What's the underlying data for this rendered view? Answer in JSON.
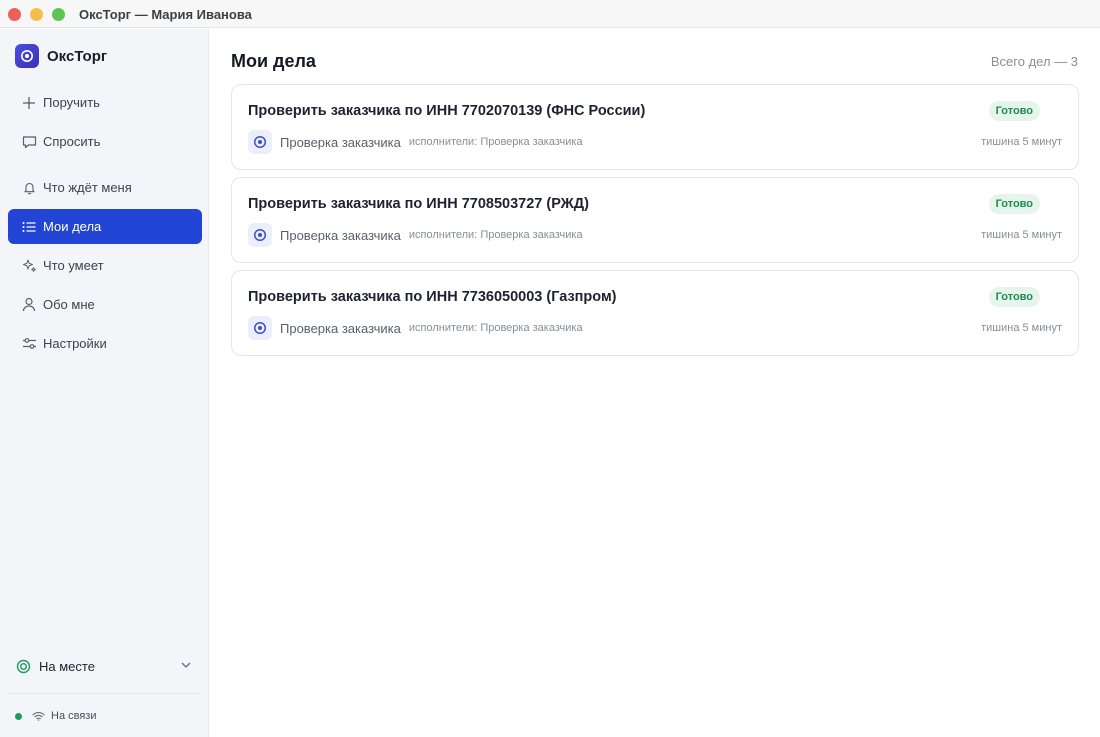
{
  "window": {
    "title": "ОксТорг — Мария Иванова"
  },
  "brand": {
    "name": "ОксТорг"
  },
  "sidebar": {
    "items": [
      {
        "label": "Поручить",
        "icon": "plus-icon",
        "active": false
      },
      {
        "label": "Спросить",
        "icon": "chat-icon",
        "active": false
      },
      {
        "label": "Что ждёт меня",
        "icon": "bell-icon",
        "active": false
      },
      {
        "label": "Мои дела",
        "icon": "list-icon",
        "active": true
      },
      {
        "label": "Что умеет",
        "icon": "sparkle-icon",
        "active": false
      },
      {
        "label": "Обо мне",
        "icon": "user-icon",
        "active": false
      },
      {
        "label": "Настройки",
        "icon": "sliders-icon",
        "active": false
      }
    ],
    "presence": {
      "label": "На месте",
      "icon": "presence-icon"
    },
    "connection": {
      "label": "На связи",
      "icon": "wifi-icon",
      "color": "#1d9a5f"
    }
  },
  "main": {
    "title": "Мои дела",
    "total": "Всего дел — 3",
    "tasks": [
      {
        "title": "Проверить заказчика по ИНН 7702070139 (ФНС России)",
        "status": "Готово",
        "agent": "Проверка заказчика",
        "performers": "исполнители: Проверка заказчика",
        "quiet": "тишина 5 минут"
      },
      {
        "title": "Проверить заказчика по ИНН 7708503727 (РЖД)",
        "status": "Готово",
        "agent": "Проверка заказчика",
        "performers": "исполнители: Проверка заказчика",
        "quiet": "тишина 5 минут"
      },
      {
        "title": "Проверить заказчика по ИНН 7736050003 (Газпром)",
        "status": "Готово",
        "agent": "Проверка заказчика",
        "performers": "исполнители: Проверка заказчика",
        "quiet": "тишина 5 минут"
      }
    ]
  },
  "colors": {
    "accent": "#2245d6",
    "status_done_bg": "#e6f5ec",
    "status_done_text": "#1e8c52"
  }
}
